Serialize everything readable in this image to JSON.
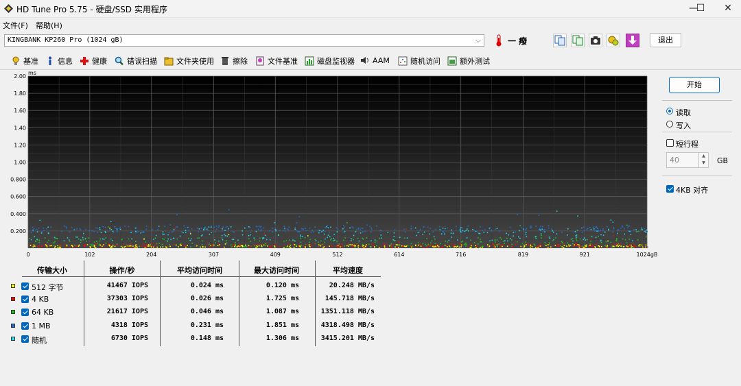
{
  "window": {
    "title": "HD Tune Pro 5.75 - 硬盘/SSD 实用程序",
    "minimize": "—",
    "maximize": "☐",
    "close": "✕"
  },
  "menu": [
    "文件(F)",
    "帮助(H)"
  ],
  "drive": {
    "selected": "KINGBANK KP260 Pro (1024 gB)"
  },
  "temperature": "一 癈",
  "exit_label": "退出",
  "tabs": [
    "基准",
    "信息",
    "健康",
    "错误扫描",
    "文件夹使用",
    "擦除",
    "文件基准",
    "磁盘监视器",
    "AAM",
    "随机访问",
    "额外测试"
  ],
  "side": {
    "start_label": "开始",
    "read_label": "读取",
    "write_label": "写入",
    "mode": "read",
    "short_stroke_label": "短行程",
    "short_stroke_checked": false,
    "short_stroke_value": "40",
    "short_stroke_unit": "GB",
    "align_label": "4KB 对齐",
    "align_checked": true
  },
  "table": {
    "headers": [
      "传输大小",
      "操作/秒",
      "平均访问时间",
      "最大访问时间",
      "平均速度"
    ],
    "rows": [
      {
        "size": "512 字节",
        "color": "#ffff00",
        "checked": true,
        "ops": "41467 IOPS",
        "avg": "0.024 ms",
        "max": "0.120 ms",
        "speed": "20.248 MB/s"
      },
      {
        "size": "4 KB",
        "color": "#e81010",
        "checked": true,
        "ops": "37303 IOPS",
        "avg": "0.026 ms",
        "max": "1.725 ms",
        "speed": "145.718 MB/s"
      },
      {
        "size": "64 KB",
        "color": "#20c020",
        "checked": true,
        "ops": "21617 IOPS",
        "avg": "0.046 ms",
        "max": "1.087 ms",
        "speed": "1351.118 MB/s"
      },
      {
        "size": "1 MB",
        "color": "#1e6ed6",
        "checked": true,
        "ops": "4318 IOPS",
        "avg": "0.231 ms",
        "max": "1.851 ms",
        "speed": "4318.498 MB/s"
      },
      {
        "size": "随机",
        "color": "#20d8e8",
        "checked": true,
        "ops": "6730 IOPS",
        "avg": "0.148 ms",
        "max": "1.306 ms",
        "speed": "3415.201 MB/s"
      }
    ]
  },
  "chart_data": {
    "type": "scatter",
    "ylabel": "ms",
    "ylim": [
      0,
      2.0
    ],
    "xlim": [
      0,
      1024
    ],
    "y_ticks": [
      "2.00",
      "1.80",
      "1.60",
      "1.40",
      "1.20",
      "1.00",
      "0.800",
      "0.600",
      "0.400",
      "0.200"
    ],
    "x_ticks": [
      "0",
      "102",
      "204",
      "307",
      "409",
      "512",
      "614",
      "716",
      "819",
      "921",
      "1024gB"
    ],
    "grid": true,
    "series": [
      {
        "color": "#ffff00",
        "band": [
          0.005,
          0.04
        ]
      },
      {
        "color": "#e81010",
        "band": [
          0.005,
          0.05
        ]
      },
      {
        "color": "#20c020",
        "band": [
          0.01,
          0.12
        ]
      },
      {
        "color": "#1e6ed6",
        "band": [
          0.18,
          0.26
        ]
      },
      {
        "color": "#20d8e8",
        "band": [
          0.08,
          0.25
        ]
      }
    ]
  }
}
